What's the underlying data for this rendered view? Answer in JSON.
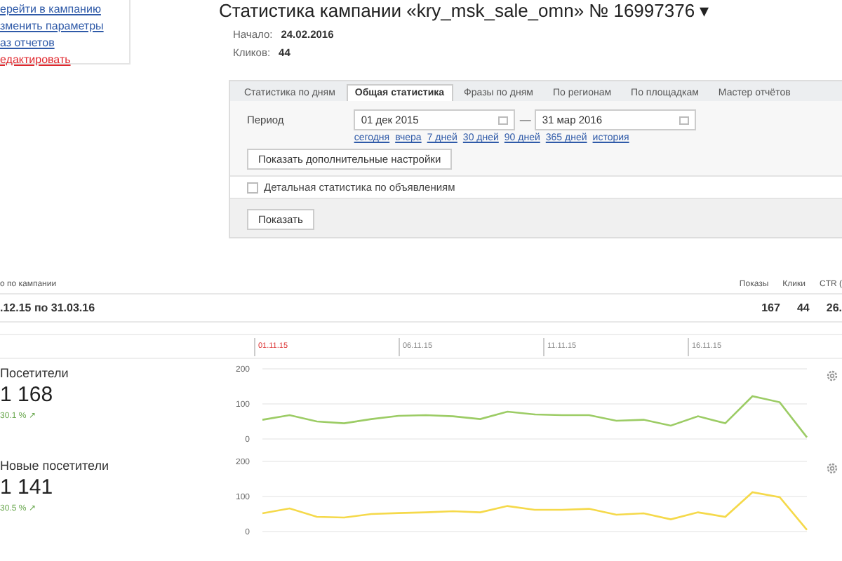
{
  "sidebar": {
    "links": [
      {
        "label": "ерейти в кампанию",
        "kind": "link"
      },
      {
        "label": "зменить параметры",
        "kind": "link"
      },
      {
        "label": "аз отчетов",
        "kind": "link"
      },
      {
        "label": "едактировать",
        "kind": "danger"
      }
    ]
  },
  "campaign": {
    "title": "Статистика кампании «kry_msk_sale_omn» № 16997376 ▾",
    "start_label": "Начало:",
    "start": "24.02.2016",
    "clicks_label": "Кликов:",
    "clicks": "44"
  },
  "tabs": [
    {
      "label": "Статистика по дням",
      "selected": false
    },
    {
      "label": "Общая статистика",
      "selected": true
    },
    {
      "label": "Фразы по дням",
      "selected": false
    },
    {
      "label": "По регионам",
      "selected": false
    },
    {
      "label": "По площадкам",
      "selected": false
    },
    {
      "label": "Мастер отчётов",
      "selected": false
    }
  ],
  "period": {
    "label": "Период",
    "from": "01 дек 2015",
    "separator": "—",
    "to": "31 мар 2016",
    "presets": [
      "сегодня",
      "вчера",
      "7 дней",
      "30 дней",
      "90 дней",
      "365 дней",
      "история"
    ]
  },
  "more_settings_button": "Показать дополнительные настройки",
  "detail_checkbox": {
    "label": "Детальная статистика по объявлениям",
    "checked": false
  },
  "show_button": "Показать",
  "summary": {
    "heading": "о по кампании",
    "columns": [
      "Показы",
      "Клики",
      "CTR ("
    ],
    "period": ".12.15 по 31.03.16",
    "values": [
      "167",
      "44",
      "26."
    ]
  },
  "timeline": [
    {
      "label": "01.11.15",
      "selected": true
    },
    {
      "label": "06.11.15",
      "selected": false
    },
    {
      "label": "11.11.15",
      "selected": false
    },
    {
      "label": "16.11.15",
      "selected": false
    }
  ],
  "metrics": [
    {
      "title": "Посетители",
      "value": "1 168",
      "change": "30.1 % ↗",
      "chart_data": {
        "type": "line",
        "ylim": [
          0,
          200
        ],
        "yticks": [
          0,
          100,
          200
        ],
        "series": [
          {
            "color": "#9ccc65",
            "values": [
              55,
              68,
              50,
              45,
              57,
              66,
              68,
              65,
              57,
              78,
              70,
              68,
              68,
              52,
              55,
              38,
              65,
              45,
              122,
              105,
              5
            ]
          }
        ]
      }
    },
    {
      "title": "Новые посетители",
      "value": "1 141",
      "change": "30.5 % ↗",
      "chart_data": {
        "type": "line",
        "ylim": [
          0,
          200
        ],
        "yticks": [
          0,
          100,
          200
        ],
        "series": [
          {
            "color": "#f5d94a",
            "values": [
              52,
              66,
              42,
              40,
              50,
              53,
              55,
              58,
              55,
              73,
              62,
              62,
              65,
              48,
              52,
              35,
              55,
              42,
              112,
              98,
              5
            ]
          }
        ]
      }
    }
  ]
}
